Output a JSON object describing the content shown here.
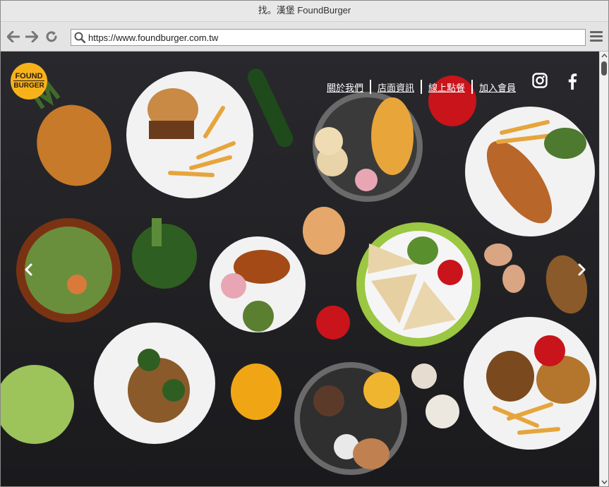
{
  "window": {
    "title": "找。漢堡 FoundBurger"
  },
  "toolbar": {
    "url": "https://www.foundburger.com.tw"
  },
  "site": {
    "logo": {
      "line1": "FOUND",
      "line2": "BURGER"
    },
    "nav": [
      {
        "label": "關於我們"
      },
      {
        "label": "店面資訊"
      },
      {
        "label": "線上點餐"
      },
      {
        "label": "加入會員"
      }
    ],
    "social": [
      "instagram-icon",
      "facebook-icon"
    ]
  },
  "colors": {
    "background": "#1f1f22",
    "logo": "#f7b21b",
    "nav_text": "#ffffff"
  }
}
